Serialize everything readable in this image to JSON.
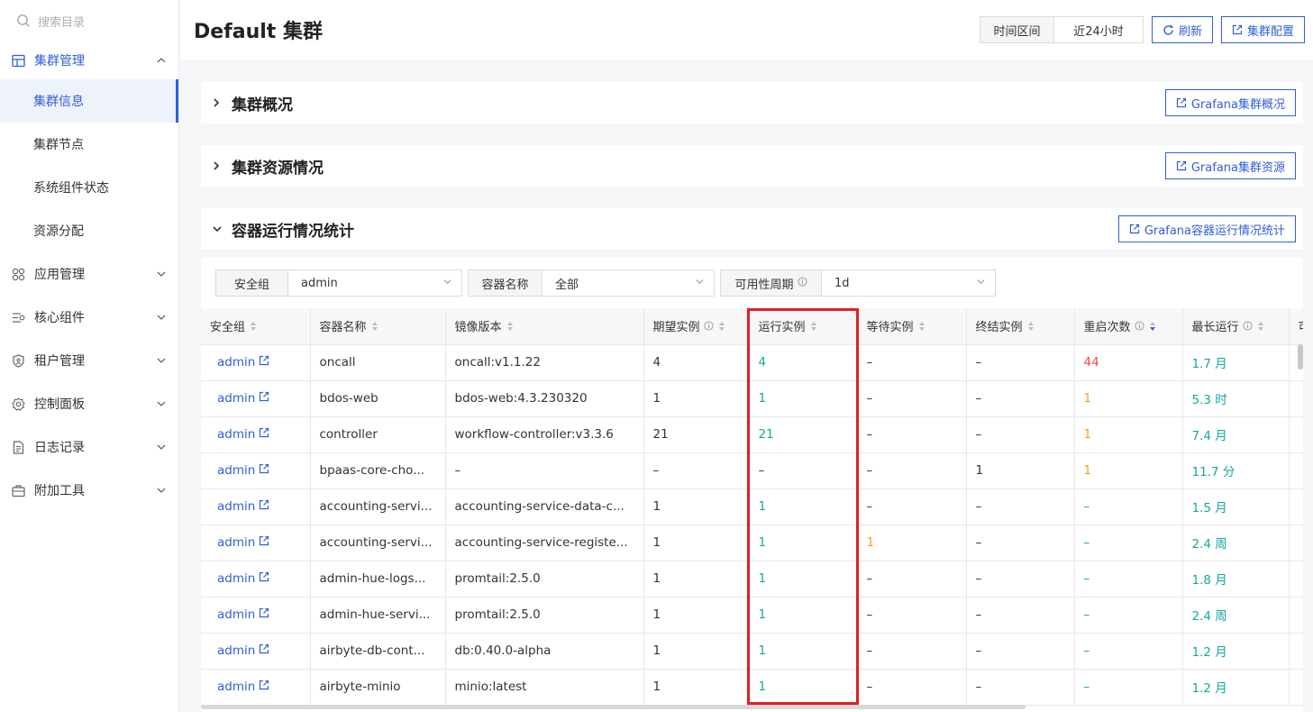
{
  "sidebar": {
    "search_placeholder": "搜索目录",
    "groups": [
      {
        "label": "集群管理",
        "expanded": true,
        "icon": "cluster-icon",
        "children": [
          "集群信息",
          "集群节点",
          "系统组件状态",
          "资源分配"
        ],
        "active_child": "集群信息"
      },
      {
        "label": "应用管理",
        "icon": "apps-icon"
      },
      {
        "label": "核心组件",
        "icon": "components-icon"
      },
      {
        "label": "租户管理",
        "icon": "shield-icon"
      },
      {
        "label": "控制面板",
        "icon": "gear-icon"
      },
      {
        "label": "日志记录",
        "icon": "document-icon"
      },
      {
        "label": "附加工具",
        "icon": "toolbox-icon"
      }
    ]
  },
  "header": {
    "title": "Default 集群",
    "time_range_label": "时间区间",
    "time_range_value": "近24小时",
    "refresh_label": "刷新",
    "cluster_config_label": "集群配置"
  },
  "sections": [
    {
      "title": "集群概况",
      "expanded": false,
      "action": "Grafana集群概况"
    },
    {
      "title": "集群资源情况",
      "expanded": false,
      "action": "Grafana集群资源"
    },
    {
      "title": "容器运行情况统计",
      "expanded": true,
      "action": "Grafana容器运行情况统计"
    }
  ],
  "filters": [
    {
      "label": "安全组",
      "value": "admin"
    },
    {
      "label": "容器名称",
      "value": "全部"
    },
    {
      "label": "可用性周期",
      "value": "1d",
      "has_info": true
    }
  ],
  "table": {
    "columns": [
      {
        "label": "安全组",
        "sortable": true
      },
      {
        "label": "容器名称",
        "sortable": true
      },
      {
        "label": "镜像版本",
        "sortable": true
      },
      {
        "label": "期望实例",
        "info": true,
        "sortable": true
      },
      {
        "label": "运行实例",
        "sortable": true
      },
      {
        "label": "等待实例",
        "sortable": true
      },
      {
        "label": "终结实例",
        "sortable": true
      },
      {
        "label": "重启次数",
        "info": true,
        "sortable": true,
        "sorted": "desc"
      },
      {
        "label": "最长运行",
        "info": true,
        "sortable": true
      },
      {
        "label": "可"
      }
    ],
    "rows": [
      {
        "group": "admin",
        "name": "oncall",
        "image": "oncall:v1.1.22",
        "expected": "4",
        "running": "4",
        "waiting": "–",
        "terminated": "–",
        "restarts": "44",
        "restarts_color": "red",
        "longest": "1.7 月"
      },
      {
        "group": "admin",
        "name": "bdos-web",
        "image": "bdos-web:4.3.230320",
        "expected": "1",
        "running": "1",
        "waiting": "–",
        "terminated": "–",
        "restarts": "1",
        "restarts_color": "orange",
        "longest": "5.3 时"
      },
      {
        "group": "admin",
        "name": "controller",
        "image": "workflow-controller:v3.3.6",
        "expected": "21",
        "running": "21",
        "waiting": "–",
        "terminated": "–",
        "restarts": "1",
        "restarts_color": "orange",
        "longest": "7.4 月"
      },
      {
        "group": "admin",
        "name": "bpaas-core-cho...",
        "image": "–",
        "expected": "–",
        "running": "–",
        "waiting": "–",
        "terminated": "1",
        "restarts": "1",
        "restarts_color": "orange",
        "longest": "11.7 分"
      },
      {
        "group": "admin",
        "name": "accounting-servi...",
        "image": "accounting-service-data-c...",
        "expected": "1",
        "running": "1",
        "waiting": "–",
        "terminated": "–",
        "restarts": "–",
        "restarts_color": "green",
        "longest": "1.5 月"
      },
      {
        "group": "admin",
        "name": "accounting-servi...",
        "image": "accounting-service-registe...",
        "expected": "1",
        "running": "1",
        "waiting": "1",
        "terminated": "–",
        "restarts": "–",
        "restarts_color": "green",
        "longest": "2.4 周"
      },
      {
        "group": "admin",
        "name": "admin-hue-logs...",
        "image": "promtail:2.5.0",
        "expected": "1",
        "running": "1",
        "waiting": "–",
        "terminated": "–",
        "restarts": "–",
        "restarts_color": "green",
        "longest": "1.8 月"
      },
      {
        "group": "admin",
        "name": "admin-hue-servi...",
        "image": "promtail:2.5.0",
        "expected": "1",
        "running": "1",
        "waiting": "–",
        "terminated": "–",
        "restarts": "–",
        "restarts_color": "green",
        "longest": "2.4 周"
      },
      {
        "group": "admin",
        "name": "airbyte-db-cont...",
        "image": "db:0.40.0-alpha",
        "expected": "1",
        "running": "1",
        "waiting": "–",
        "terminated": "–",
        "restarts": "–",
        "restarts_color": "green",
        "longest": "1.2 月"
      },
      {
        "group": "admin",
        "name": "airbyte-minio",
        "image": "minio:latest",
        "expected": "1",
        "running": "1",
        "waiting": "–",
        "terminated": "–",
        "restarts": "–",
        "restarts_color": "green",
        "longest": "1.2 月"
      }
    ]
  },
  "colors": {
    "accent": "#2f5fd8",
    "green": "#13a89e",
    "orange": "#fa9c1b",
    "red": "#f04848",
    "highlight": "#e02020"
  }
}
